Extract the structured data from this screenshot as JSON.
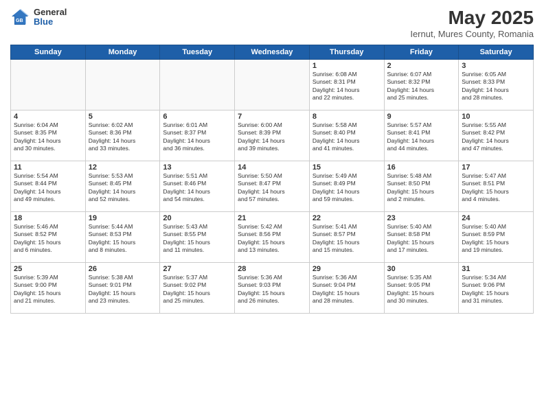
{
  "logo": {
    "general": "General",
    "blue": "Blue"
  },
  "title": {
    "month_year": "May 2025",
    "location": "Iernut, Mures County, Romania"
  },
  "weekdays": [
    "Sunday",
    "Monday",
    "Tuesday",
    "Wednesday",
    "Thursday",
    "Friday",
    "Saturday"
  ],
  "weeks": [
    [
      {
        "day": "",
        "info": ""
      },
      {
        "day": "",
        "info": ""
      },
      {
        "day": "",
        "info": ""
      },
      {
        "day": "",
        "info": ""
      },
      {
        "day": "1",
        "info": "Sunrise: 6:08 AM\nSunset: 8:31 PM\nDaylight: 14 hours\nand 22 minutes."
      },
      {
        "day": "2",
        "info": "Sunrise: 6:07 AM\nSunset: 8:32 PM\nDaylight: 14 hours\nand 25 minutes."
      },
      {
        "day": "3",
        "info": "Sunrise: 6:05 AM\nSunset: 8:33 PM\nDaylight: 14 hours\nand 28 minutes."
      }
    ],
    [
      {
        "day": "4",
        "info": "Sunrise: 6:04 AM\nSunset: 8:35 PM\nDaylight: 14 hours\nand 30 minutes."
      },
      {
        "day": "5",
        "info": "Sunrise: 6:02 AM\nSunset: 8:36 PM\nDaylight: 14 hours\nand 33 minutes."
      },
      {
        "day": "6",
        "info": "Sunrise: 6:01 AM\nSunset: 8:37 PM\nDaylight: 14 hours\nand 36 minutes."
      },
      {
        "day": "7",
        "info": "Sunrise: 6:00 AM\nSunset: 8:39 PM\nDaylight: 14 hours\nand 39 minutes."
      },
      {
        "day": "8",
        "info": "Sunrise: 5:58 AM\nSunset: 8:40 PM\nDaylight: 14 hours\nand 41 minutes."
      },
      {
        "day": "9",
        "info": "Sunrise: 5:57 AM\nSunset: 8:41 PM\nDaylight: 14 hours\nand 44 minutes."
      },
      {
        "day": "10",
        "info": "Sunrise: 5:55 AM\nSunset: 8:42 PM\nDaylight: 14 hours\nand 47 minutes."
      }
    ],
    [
      {
        "day": "11",
        "info": "Sunrise: 5:54 AM\nSunset: 8:44 PM\nDaylight: 14 hours\nand 49 minutes."
      },
      {
        "day": "12",
        "info": "Sunrise: 5:53 AM\nSunset: 8:45 PM\nDaylight: 14 hours\nand 52 minutes."
      },
      {
        "day": "13",
        "info": "Sunrise: 5:51 AM\nSunset: 8:46 PM\nDaylight: 14 hours\nand 54 minutes."
      },
      {
        "day": "14",
        "info": "Sunrise: 5:50 AM\nSunset: 8:47 PM\nDaylight: 14 hours\nand 57 minutes."
      },
      {
        "day": "15",
        "info": "Sunrise: 5:49 AM\nSunset: 8:49 PM\nDaylight: 14 hours\nand 59 minutes."
      },
      {
        "day": "16",
        "info": "Sunrise: 5:48 AM\nSunset: 8:50 PM\nDaylight: 15 hours\nand 2 minutes."
      },
      {
        "day": "17",
        "info": "Sunrise: 5:47 AM\nSunset: 8:51 PM\nDaylight: 15 hours\nand 4 minutes."
      }
    ],
    [
      {
        "day": "18",
        "info": "Sunrise: 5:46 AM\nSunset: 8:52 PM\nDaylight: 15 hours\nand 6 minutes."
      },
      {
        "day": "19",
        "info": "Sunrise: 5:44 AM\nSunset: 8:53 PM\nDaylight: 15 hours\nand 8 minutes."
      },
      {
        "day": "20",
        "info": "Sunrise: 5:43 AM\nSunset: 8:55 PM\nDaylight: 15 hours\nand 11 minutes."
      },
      {
        "day": "21",
        "info": "Sunrise: 5:42 AM\nSunset: 8:56 PM\nDaylight: 15 hours\nand 13 minutes."
      },
      {
        "day": "22",
        "info": "Sunrise: 5:41 AM\nSunset: 8:57 PM\nDaylight: 15 hours\nand 15 minutes."
      },
      {
        "day": "23",
        "info": "Sunrise: 5:40 AM\nSunset: 8:58 PM\nDaylight: 15 hours\nand 17 minutes."
      },
      {
        "day": "24",
        "info": "Sunrise: 5:40 AM\nSunset: 8:59 PM\nDaylight: 15 hours\nand 19 minutes."
      }
    ],
    [
      {
        "day": "25",
        "info": "Sunrise: 5:39 AM\nSunset: 9:00 PM\nDaylight: 15 hours\nand 21 minutes."
      },
      {
        "day": "26",
        "info": "Sunrise: 5:38 AM\nSunset: 9:01 PM\nDaylight: 15 hours\nand 23 minutes."
      },
      {
        "day": "27",
        "info": "Sunrise: 5:37 AM\nSunset: 9:02 PM\nDaylight: 15 hours\nand 25 minutes."
      },
      {
        "day": "28",
        "info": "Sunrise: 5:36 AM\nSunset: 9:03 PM\nDaylight: 15 hours\nand 26 minutes."
      },
      {
        "day": "29",
        "info": "Sunrise: 5:36 AM\nSunset: 9:04 PM\nDaylight: 15 hours\nand 28 minutes."
      },
      {
        "day": "30",
        "info": "Sunrise: 5:35 AM\nSunset: 9:05 PM\nDaylight: 15 hours\nand 30 minutes."
      },
      {
        "day": "31",
        "info": "Sunrise: 5:34 AM\nSunset: 9:06 PM\nDaylight: 15 hours\nand 31 minutes."
      }
    ]
  ]
}
